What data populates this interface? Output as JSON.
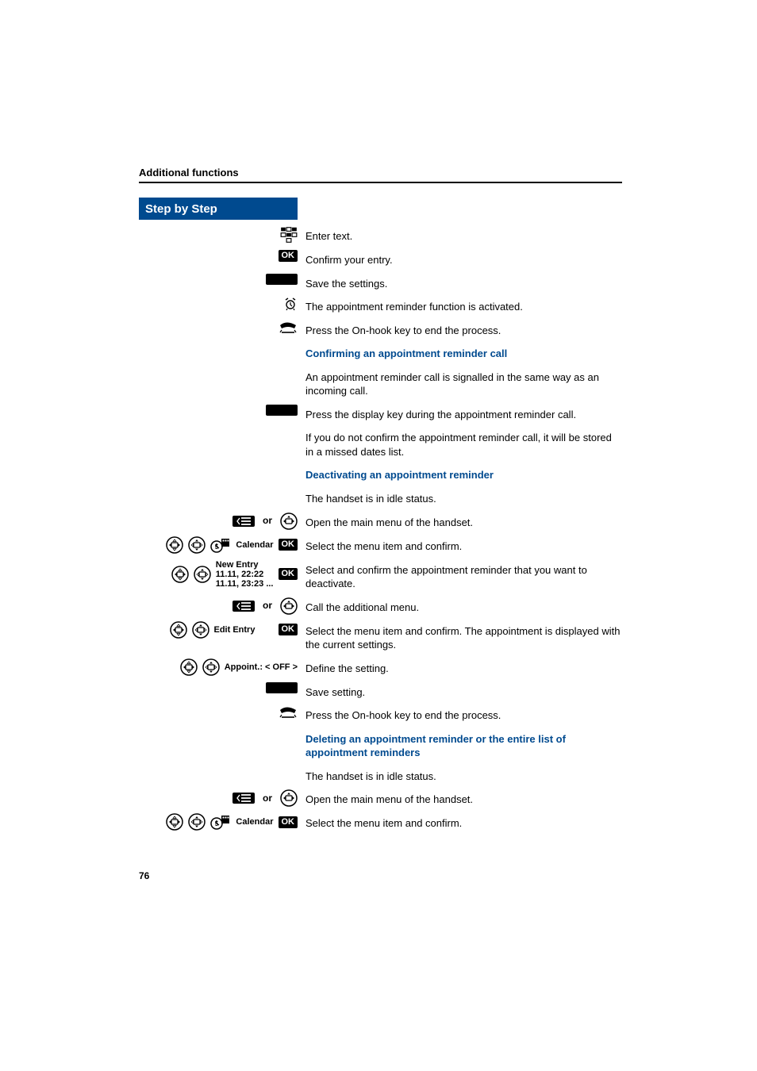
{
  "header": {
    "title": "Additional functions"
  },
  "stepbar": {
    "label": "Step by Step"
  },
  "keys": {
    "ok": "OK",
    "or": "or"
  },
  "rows": {
    "r1": "Enter text.",
    "r2": "Confirm your entry.",
    "r3": "Save the settings.",
    "r4": "The appointment reminder function is activated.",
    "r5": "Press the On-hook key to end the process.",
    "h1": "Confirming an appointment reminder call",
    "r6": "An appointment reminder call is signalled in the same way as an incoming call.",
    "r7": "Press the display key during the appointment reminder call.",
    "r8": "If you do not confirm the appointment reminder call, it will be stored in a missed dates list.",
    "h2": "Deactivating an appointment reminder",
    "r9": "The handset is in idle status.",
    "r10": "Open the main menu of the handset.",
    "r11": {
      "label": "Calendar",
      "text": "Select the menu item and confirm."
    },
    "r12": {
      "label1": "New Entry",
      "label2": "11.11, 22:22",
      "label3": "11.11, 23:23 ...",
      "text": "Select and confirm the appointment reminder that you want to deactivate."
    },
    "r13": "Call the additional menu.",
    "r14": {
      "label": "Edit Entry",
      "text": "Select the menu item and confirm. The appointment is displayed with the current settings."
    },
    "r15": {
      "label": "Appoint.: < OFF >",
      "text": "Define the setting."
    },
    "r16": "Save setting.",
    "r17": "Press the On-hook key to end the process.",
    "h3": "Deleting an appointment reminder or the entire list of appointment reminders",
    "r18": "The handset is in idle status.",
    "r19": "Open the main menu of the handset.",
    "r20": {
      "label": "Calendar",
      "text": "Select the menu item and confirm."
    }
  },
  "footer": {
    "page": "76"
  }
}
